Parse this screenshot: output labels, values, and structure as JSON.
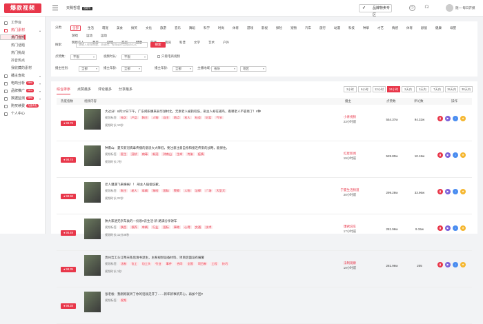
{
  "header": {
    "logo": "爆款视频",
    "account": "天赐哲理",
    "account_badge": "视频号",
    "brand_button": "品牌特卖专区",
    "user_name": "随一·每日开摸"
  },
  "sidebar": [
    {
      "label": "工作台",
      "icon": "monitor-icon",
      "active": false,
      "sub": false
    },
    {
      "label": "热门素材",
      "icon": "fire-icon",
      "active": true,
      "sub": false,
      "arrow": "▴"
    },
    {
      "label": "热门视频",
      "sub": true,
      "selected": true
    },
    {
      "label": "热门音乐",
      "sub": true
    },
    {
      "label": "热门话题",
      "sub": true
    },
    {
      "label": "热门挑战",
      "sub": true
    },
    {
      "label": "抖音热点",
      "sub": true
    },
    {
      "label": "我收藏的素材",
      "sub": true
    },
    {
      "label": "播主查找",
      "icon": "search-user-icon",
      "sub": false,
      "arrow": "▾"
    },
    {
      "label": "电商分析",
      "icon": "cart-icon",
      "sub": false,
      "arrow": "▾",
      "new": "New"
    },
    {
      "label": "品牌推广",
      "icon": "flag-icon",
      "sub": false,
      "arrow": "▾",
      "new": "New"
    },
    {
      "label": "数据监测",
      "icon": "chart-icon",
      "sub": false,
      "arrow": "▾",
      "new": "New"
    },
    {
      "label": "购买续费",
      "icon": "vip-icon",
      "sub": false,
      "hot": "充值有礼"
    },
    {
      "label": "个人中心",
      "icon": "user-icon",
      "sub": false
    }
  ],
  "filters": {
    "category_label": "分类:",
    "categories_row1": [
      "全部",
      "生活",
      "萌宠",
      "美食",
      "搞笑",
      "文化",
      "旅游",
      "音乐",
      "舞蹈",
      "科学",
      "时尚",
      "体育",
      "游戏",
      "影视",
      "探险",
      "宠物",
      "汽车",
      "旅行",
      "动漫",
      "科技",
      "种草",
      "才艺",
      "情感",
      "体育",
      "颜值",
      "健康",
      "母婴",
      "游戏",
      "运动",
      "运动"
    ],
    "categories_row2": [
      "明星名人",
      "教育",
      "剧情",
      "家居",
      "健康",
      "游戏",
      "资讯",
      "科普",
      "文学",
      "艺术",
      "户外"
    ],
    "search_label": "搜索:",
    "search_placeholder": "请输入视频标题、关键词、视频或作品描述试试",
    "search_button": "搜索",
    "likes_label": "点赞数:",
    "likes_value": "不限",
    "duration_label": "视频时长:",
    "duration_value": "不限",
    "ecommerce_checkbox": "只看电商视频",
    "gender_label": "播主性别:",
    "gender_value": "全部",
    "age_label": "播主年龄:",
    "age_value": "全部",
    "audience_label": "播主年龄:",
    "audience_value": "全部",
    "region_label": "主播地域:",
    "region_value": "省份",
    "city_value": "地区"
  },
  "tabs": [
    "综合排序",
    "点赞最多",
    "评论最多",
    "分享最多"
  ],
  "time_filters": [
    "2小时",
    "6小时",
    "12小时",
    "24小时",
    "2天内",
    "3天内",
    "7天内",
    "15天内",
    "30天内"
  ],
  "active_time_filter": 3,
  "table_headers": [
    "热度指数",
    "视频内容",
    "播主",
    "点赞数",
    "评论数",
    "操作"
  ],
  "keywords_label": "视频标签:",
  "duration_label": "视频时长:",
  "rows": [
    {
      "score": "98.78",
      "title": "大过分！8月17日下午，广东揭阳惠来县华湖村北，无辜老人被狗咬伤，刑主人却在捕鸟，看哪老人不容易了！#种",
      "keywords": [
        "社区",
        "产品",
        "狗主",
        "人物",
        "自主",
        "地点",
        "名人",
        "社会",
        "妇女",
        "气节"
      ],
      "duration": "13秒",
      "category": "小青视频",
      "ago": "23小时前",
      "likes": "554.37w",
      "comments": "94.32w"
    },
    {
      "score": "98.74",
      "title": "钟南山：夏天新冠病毒传播的意思大大降低，要注意注意自身和接连传染的战略，能保住。",
      "keywords": [
        "医生",
        "冠状",
        "病毒",
        "新冠",
        "钟南山",
        "生命",
        "传染",
        "疫情"
      ],
      "duration": "7秒",
      "category": "红星新闻",
      "ago": "19小时前",
      "likes": "528.80w",
      "comments": "10.18w"
    },
    {
      "score": "98.58",
      "title": "老人遭遇飞来横祸！！ 刑主人赔偿说歉。",
      "keywords": [
        "狗主",
        "老人",
        "车辆",
        "狗咬",
        "国际",
        "警察",
        "人物",
        "法律",
        "广场",
        "大型犬"
      ],
      "duration": "22秒",
      "category": "宁夏生活频道",
      "ago": "20小时前",
      "likes": "299.28w",
      "comments": "33.96w"
    },
    {
      "score": "98.49",
      "title": "陕大家透无奈车类的一份恩#云生活·新·路满分享讲车",
      "keywords": [
        "陕西",
        "保养",
        "车辆",
        "行业",
        "国际",
        "事故",
        "心得",
        "交通",
        "技术"
      ],
      "duration": "11分38秒",
      "category": "爆君说车",
      "ago": "17小时前",
      "likes": "281.96w",
      "comments": "9.15w"
    },
    {
      "score": "98.35",
      "title": "贵州哲工头订两天陈后请书退生，主惹视频设备材料，项目后面设有报警",
      "keywords": [
        "法制",
        "包工",
        "包工头",
        "行业",
        "事件",
        "合同",
        "全国",
        "项目新",
        "工程",
        "技巧"
      ],
      "duration": "1秒",
      "category": "法制观察",
      "ago": "19小时前",
      "likes": "281.96w",
      "comments": "205"
    },
    {
      "score": "98.28",
      "title": "张老板：我刚刚就听了你的话就走开了……新年新事新开心，再加个团#",
      "keywords": [
        "视频"
      ],
      "duration": "",
      "category": "",
      "ago": "",
      "likes": "",
      "comments": ""
    }
  ],
  "colors": {
    "accent": "#e8374a"
  }
}
